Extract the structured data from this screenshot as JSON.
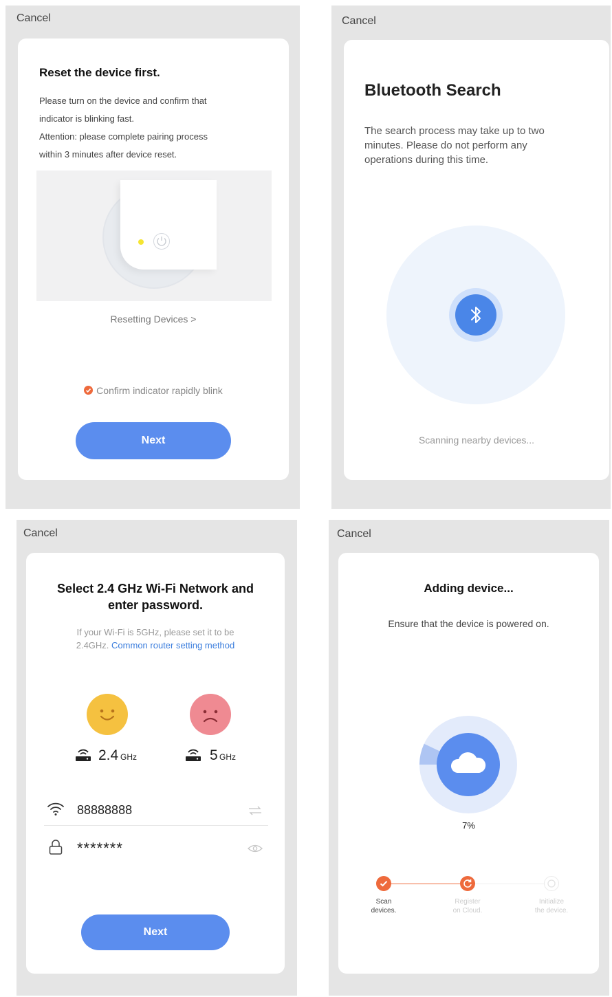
{
  "common": {
    "cancel_label": "Cancel",
    "next_label": "Next"
  },
  "reset": {
    "title": "Reset the device first.",
    "desc_lines": [
      "Please turn on the device and confirm that",
      "indicator is blinking fast.",
      "Attention: please complete pairing process",
      "within 3 minutes after device reset."
    ],
    "resetting_link": "Resetting Devices >",
    "confirm_label": "Confirm indicator rapidly blink"
  },
  "bluetooth": {
    "title": "Bluetooth Search",
    "desc_lines": [
      "The search process may take up to two",
      "minutes. Please do not perform any",
      "operations during this time."
    ],
    "status": "Scanning nearby devices..."
  },
  "wifi": {
    "title_lines": [
      "Select 2.4 GHz Wi-Fi Network and",
      "enter password."
    ],
    "hint_line1": "If your Wi-Fi is 5GHz, please set it to be",
    "hint_line2_prefix": "2.4GHz.",
    "hint_link": "Common router setting method",
    "band_good_num": "2.4",
    "band_good_unit": "GHz",
    "band_bad_num": "5",
    "band_bad_unit": "GHz",
    "ssid_value": "88888888",
    "password_value": "*******"
  },
  "adding": {
    "title": "Adding device...",
    "subtitle": "Ensure that the device is powered on.",
    "progress_label": "7%",
    "progress_fraction": 0.07,
    "steps": [
      {
        "label_line1": "Scan",
        "label_line2": "devices.",
        "state": "done"
      },
      {
        "label_line1": "Register",
        "label_line2": "on Cloud.",
        "state": "active"
      },
      {
        "label_line1": "Initialize",
        "label_line2": "the device.",
        "state": "pending"
      }
    ]
  },
  "colors": {
    "accent_blue": "#5b8dee",
    "step_orange": "#ee6a3c",
    "smile_yellow": "#f5c140",
    "sad_pink": "#ef8a92",
    "panel_gray": "#e5e5e5"
  }
}
